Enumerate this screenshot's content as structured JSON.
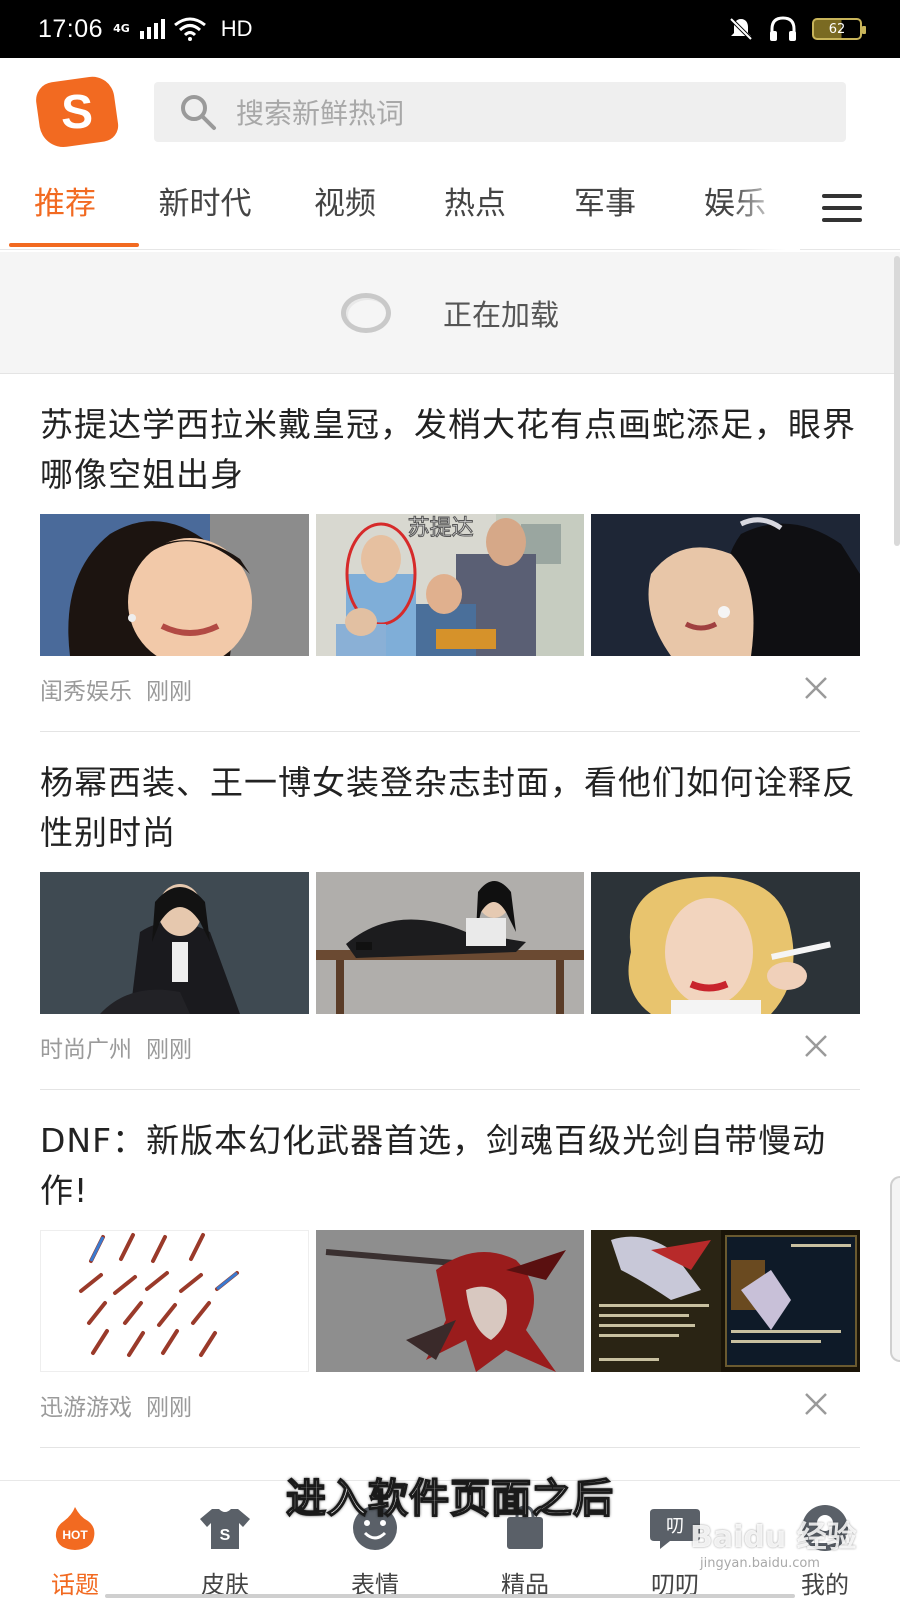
{
  "status_bar": {
    "time": "17:06",
    "network": "4G",
    "hd": "HD",
    "battery": "62"
  },
  "header": {
    "logo_letter": "S",
    "search_placeholder": "搜索新鲜热词"
  },
  "tabs": [
    {
      "label": "推荐",
      "active": true
    },
    {
      "label": "新时代"
    },
    {
      "label": "视频"
    },
    {
      "label": "热点"
    },
    {
      "label": "军事"
    },
    {
      "label": "娱乐"
    }
  ],
  "loading": {
    "text": "正在加载"
  },
  "articles": [
    {
      "title": "苏提达学西拉米戴皇冠，发梢大花有点画蛇添足，眼界哪像空姐出身",
      "source": "闺秀娱乐",
      "time": "刚刚",
      "image_overlay_text": "苏提达"
    },
    {
      "title": "杨幂西装、王一博女装登杂志封面，看他们如何诠释反性别时尚",
      "source": "时尚广州",
      "time": "刚刚"
    },
    {
      "title": "DNF：新版本幻化武器首选，剑魂百级光剑自带慢动作!",
      "source": "迅游游戏",
      "time": "刚刚"
    }
  ],
  "bottom_nav": [
    {
      "label": "话题",
      "icon": "hot-flame-icon",
      "badge": "HOT",
      "active": true
    },
    {
      "label": "皮肤",
      "icon": "tshirt-icon"
    },
    {
      "label": "表情",
      "icon": "emoji-face-icon"
    },
    {
      "label": "精品",
      "icon": "shopping-bag-icon"
    },
    {
      "label": "叨叨",
      "icon": "chat-bubble-icon",
      "icon_text": "叨"
    },
    {
      "label": "我的",
      "icon": "user-avatar-icon"
    }
  ],
  "overlay": {
    "caption": "进入软件页面之后",
    "watermark": "Baidu 经验",
    "watermark_sub": "jingyan.baidu.com"
  },
  "colors": {
    "accent": "#f26a21",
    "status_bar": "#000000",
    "meta_text": "#9a9a9a"
  }
}
